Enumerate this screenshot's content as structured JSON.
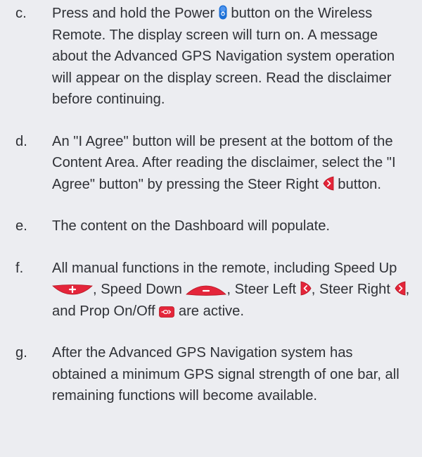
{
  "steps": [
    {
      "letter": "c.",
      "segments": [
        {
          "text": "Press and hold the Power "
        },
        {
          "icon": "power-button-icon"
        },
        {
          "text": " button on the Wireless Remote. The display screen will turn on. A message about the Advanced GPS Navigation system operation will appear on the display screen. Read the disclaimer before continuing."
        }
      ]
    },
    {
      "letter": "d.",
      "segments": [
        {
          "text": "An \"I Agree\" button will be present at the bottom of the Content Area. After reading the disclaimer, select the \"I Agree\" button\" by pressing the Steer Right "
        },
        {
          "icon": "steer-right-icon"
        },
        {
          "text": " button."
        }
      ]
    },
    {
      "letter": "e.",
      "segments": [
        {
          "text": "The content on the Dashboard will populate."
        }
      ]
    },
    {
      "letter": "f.",
      "segments": [
        {
          "text": "All manual functions in the remote, including Speed Up "
        },
        {
          "icon": "speed-up-icon"
        },
        {
          "text": ", Speed Down "
        },
        {
          "icon": "speed-down-icon"
        },
        {
          "text": ", Steer Left "
        },
        {
          "icon": "steer-left-icon"
        },
        {
          "text": ", Steer Right "
        },
        {
          "icon": "steer-right-icon"
        },
        {
          "text": ", and Prop On/Off "
        },
        {
          "icon": "prop-on-off-icon"
        },
        {
          "text": " are active."
        }
      ]
    },
    {
      "letter": "g.",
      "segments": [
        {
          "text": "After the Advanced GPS Navigation system has obtained a minimum GPS signal strength of one bar, all remaining functions will become available."
        }
      ]
    }
  ],
  "colors": {
    "background": "#ecedf1",
    "text": "#2f3136",
    "button_red": "#e4253a",
    "power_blue": "#1b6fd6"
  }
}
